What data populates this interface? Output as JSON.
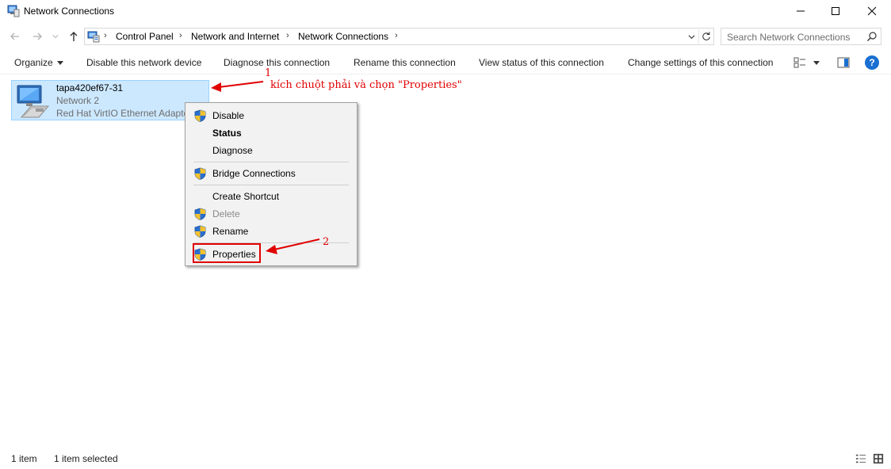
{
  "window": {
    "title": "Network Connections"
  },
  "address": {
    "crumbs": [
      "Control Panel",
      "Network and Internet",
      "Network Connections"
    ]
  },
  "search": {
    "placeholder": "Search Network Connections"
  },
  "toolbar": {
    "organize": "Organize",
    "disable": "Disable this network device",
    "diagnose": "Diagnose this connection",
    "rename": "Rename this connection",
    "view_status": "View status of this connection",
    "change_settings": "Change settings of this connection",
    "help": "?"
  },
  "item": {
    "name": "tapa420ef67-31",
    "network": "Network 2",
    "adapter": "Red Hat VirtIO Ethernet Adapter"
  },
  "context_menu": {
    "disable": "Disable",
    "status": "Status",
    "diagnose": "Diagnose",
    "bridge": "Bridge Connections",
    "shortcut": "Create Shortcut",
    "delete": "Delete",
    "rename": "Rename",
    "properties": "Properties"
  },
  "annotations": {
    "step1_number": "1",
    "step1_text": "kích chuột phải và chọn \"Properties\"",
    "step2_number": "2"
  },
  "status": {
    "count": "1 item",
    "selected": "1 item selected"
  },
  "colors": {
    "selection": "#cce8ff",
    "annotation": "#e00000",
    "accent": "#1a6fd1"
  }
}
